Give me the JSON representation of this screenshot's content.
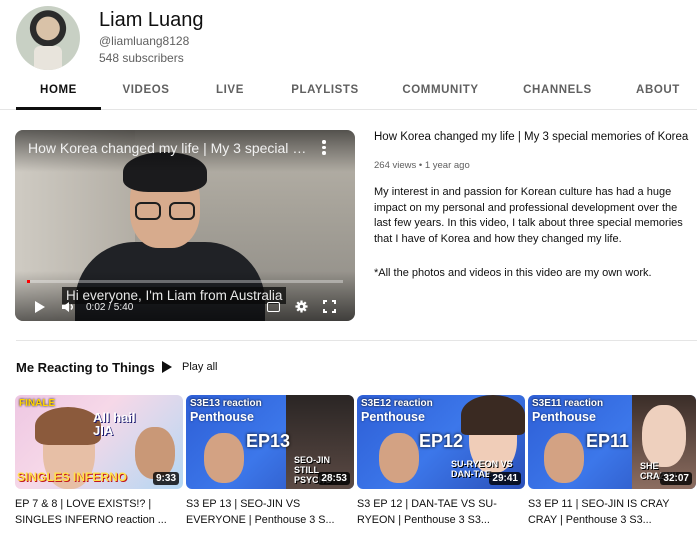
{
  "channel": {
    "name": "Liam Luang",
    "handle": "@liamluang8128",
    "subscribers": "548 subscribers"
  },
  "tabs": [
    {
      "label": "HOME",
      "active": true
    },
    {
      "label": "VIDEOS",
      "active": false
    },
    {
      "label": "LIVE",
      "active": false
    },
    {
      "label": "PLAYLISTS",
      "active": false
    },
    {
      "label": "COMMUNITY",
      "active": false
    },
    {
      "label": "CHANNELS",
      "active": false
    },
    {
      "label": "ABOUT",
      "active": false
    }
  ],
  "featured": {
    "player_title": "How Korea changed my life | My 3 special memories of Korea",
    "caption": "Hi everyone, I'm Liam from Australia",
    "time": "0:02 / 5:40",
    "progress": 0.006,
    "title": "How Korea changed my life | My 3 special memories of Korea",
    "meta": "264 views • 1 year ago",
    "description": "My interest in and passion for Korean culture has had a huge impact on my personal and professional development over the last few years. In this video, I talk about three special memories that I have of Korea and how they changed my life.",
    "description_note": "*All the photos and videos in this video are my own work."
  },
  "shelf": {
    "title": "Me Reacting to Things",
    "play_all": "Play all",
    "videos": [
      {
        "title": "EP 7 & 8 | LOVE EXISTS!? | SINGLES INFERNO reaction ...",
        "duration": "9:33",
        "thumb_badge": "FINALE",
        "thumb_text": "All hail JIA",
        "thumb_sub": "SINGLES INFERNO"
      },
      {
        "title": "S3 EP 13 | SEO-JIN VS EVERYONE | Penthouse 3 S...",
        "duration": "28:53",
        "thumb_badge": "S3E13 reaction",
        "thumb_show": "Penthouse",
        "thumb_ep": "EP13",
        "thumb_text": "SEO-JIN STILL PSYCHO"
      },
      {
        "title": "S3 EP 12 | DAN-TAE VS SU-RYEON | Penthouse 3 S3...",
        "duration": "29:41",
        "thumb_badge": "S3E12 reaction",
        "thumb_show": "Penthouse",
        "thumb_ep": "EP12",
        "thumb_text": "SU-RYEON VS DAN-TAE"
      },
      {
        "title": "S3 EP 11 | SEO-JIN IS CRAY CRAY | Penthouse 3 S3...",
        "duration": "32:07",
        "thumb_badge": "S3E11 reaction",
        "thumb_show": "Penthouse",
        "thumb_ep": "EP11",
        "thumb_text": "SHE CRAZY!!"
      }
    ]
  },
  "colors": {
    "text_primary": "#0f0f0f",
    "text_secondary": "#606060",
    "progress": "#ff0000",
    "thumb_blue": "#3c77ea"
  }
}
